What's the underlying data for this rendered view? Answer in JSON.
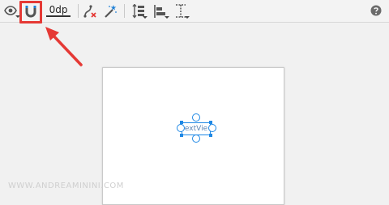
{
  "toolbar": {
    "default_margin_value": "0dp",
    "icons": [
      "eye-icon",
      "magnet-icon",
      "clear-constraints-icon",
      "infer-constraints-icon",
      "pack-icon",
      "align-icon",
      "guidelines-icon",
      "help-icon"
    ]
  },
  "design_surface": {
    "widget_label": "extVie"
  },
  "watermark": "WWW.ANDREAMININI.COM",
  "colors": {
    "highlight": "#e53935",
    "selection": "#1e88e5",
    "arrow": "#e53935"
  }
}
